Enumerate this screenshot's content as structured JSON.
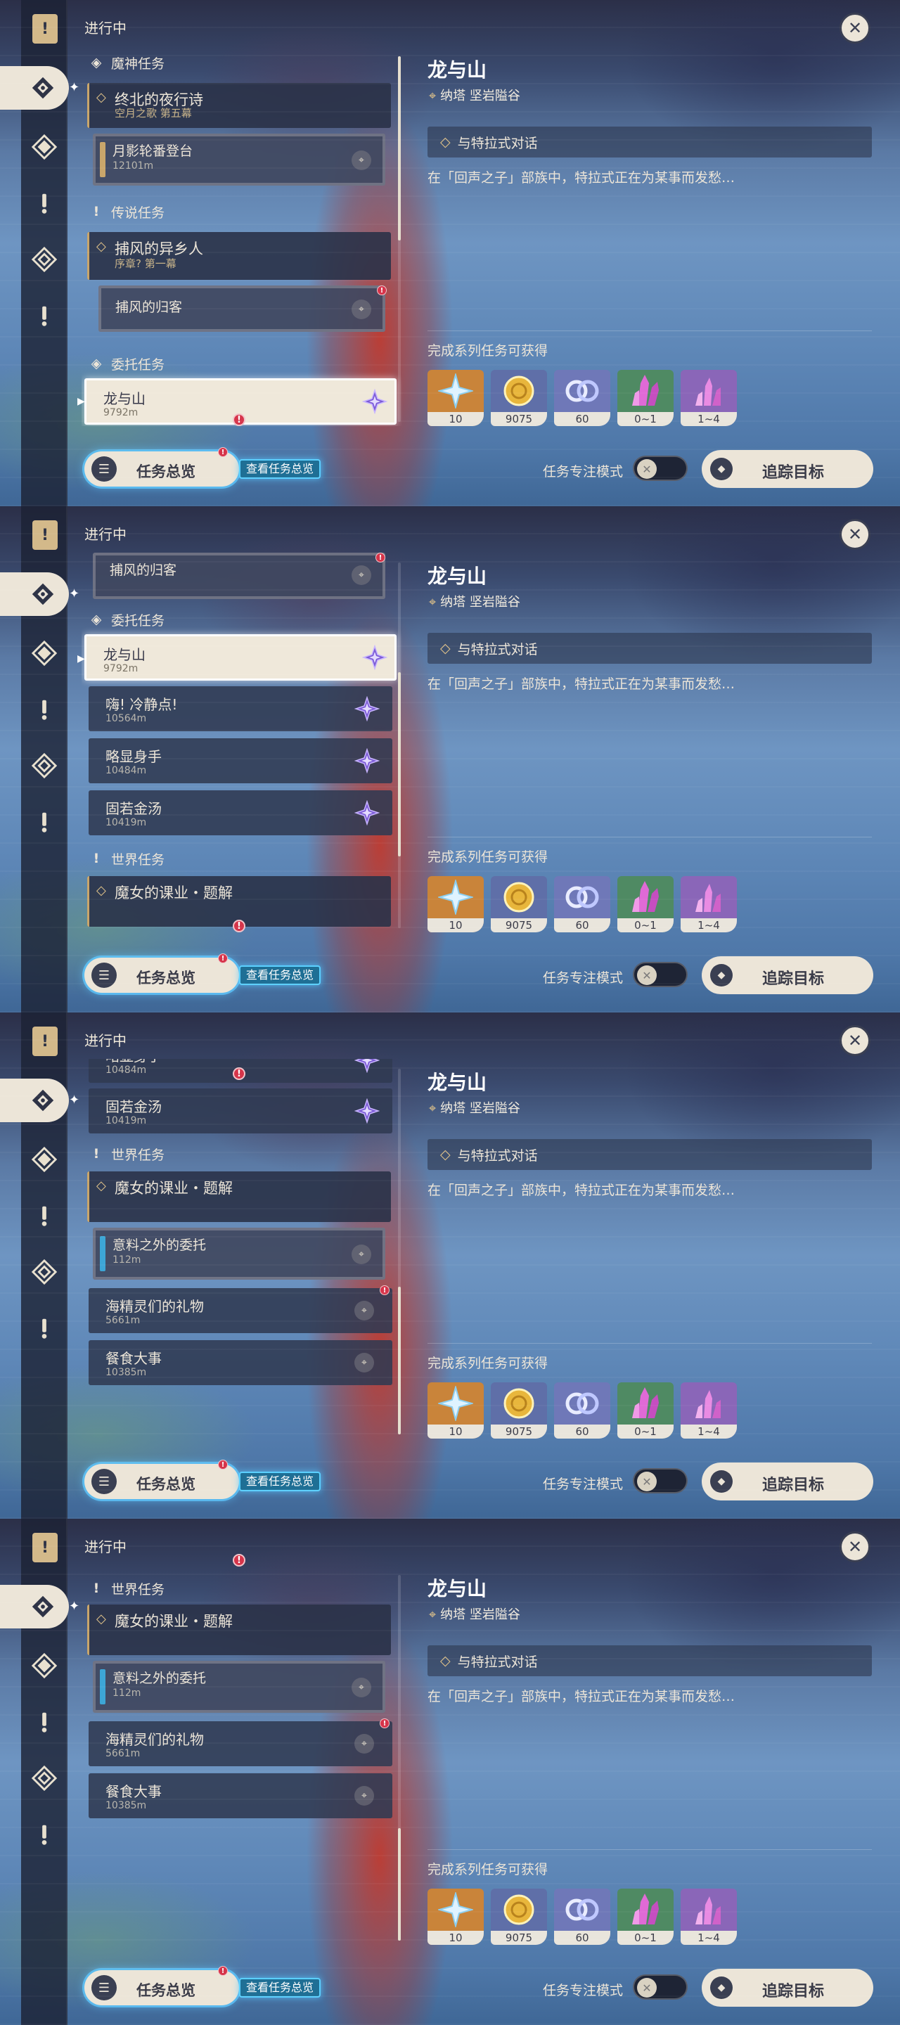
{
  "header": {
    "status_label": "进行中",
    "close_label": "✕"
  },
  "detail": {
    "title": "龙与山",
    "location": "纳塔 坚岩隘谷",
    "objective": "与特拉式对话",
    "description": "在「回声之子」部族中，特拉式正在为某事而发愁…",
    "rewards_label": "完成系列任务可获得",
    "rewards": [
      {
        "icon": "primogem-icon",
        "count": "10",
        "bg": "#c9843a"
      },
      {
        "icon": "mora-icon",
        "count": "9075",
        "bg": "#5f6fa8"
      },
      {
        "icon": "fetter-icon",
        "count": "60",
        "bg": "#6f78b8"
      },
      {
        "icon": "crystal-chunk-icon",
        "count": "0~1",
        "bg": "#4f8a63"
      },
      {
        "icon": "crystal-cluster-icon",
        "count": "1~4",
        "bg": "#8a66b8"
      }
    ]
  },
  "footer": {
    "overview_label": "任务总览",
    "overview_tip": "查看任务总览",
    "focus_mode_label": "任务专注模式",
    "track_label": "追踪目标"
  },
  "colors": {
    "accent": "#ece5d8",
    "gold": "#e2c48a",
    "alert": "#d6344a",
    "teal_bar": "#3da6d6",
    "gold_bar": "#c9a66b"
  },
  "categories": {
    "archon": "魔神任务",
    "story": "传说任务",
    "commission": "委托任务",
    "world": "世界任务"
  },
  "quests": {
    "archon_main": {
      "title": "终北的夜行诗",
      "sub": "空月之歌 第五幕"
    },
    "archon_step": {
      "title": "月影轮番登台",
      "dist": "12101m"
    },
    "story_main": {
      "title": "捕风的异乡人",
      "sub": "序章? 第一幕"
    },
    "story_step": {
      "title": "捕风的归客"
    },
    "c1": {
      "title": "龙与山",
      "dist": "9792m"
    },
    "c2": {
      "title": "嗨! 冷静点!",
      "dist": "10564m"
    },
    "c3": {
      "title": "略显身手",
      "dist": "10484m"
    },
    "c4": {
      "title": "固若金汤",
      "dist": "10419m"
    },
    "world_main": {
      "title": "魔女的课业・题解"
    },
    "w_step": {
      "title": "意料之外的委托",
      "dist": "112m"
    },
    "w2": {
      "title": "海精灵们的礼物",
      "dist": "5661m"
    },
    "w3": {
      "title": "餐食大事",
      "dist": "10385m"
    }
  },
  "scroll_progress": [
    0.05,
    0.35,
    0.7,
    1.0
  ]
}
